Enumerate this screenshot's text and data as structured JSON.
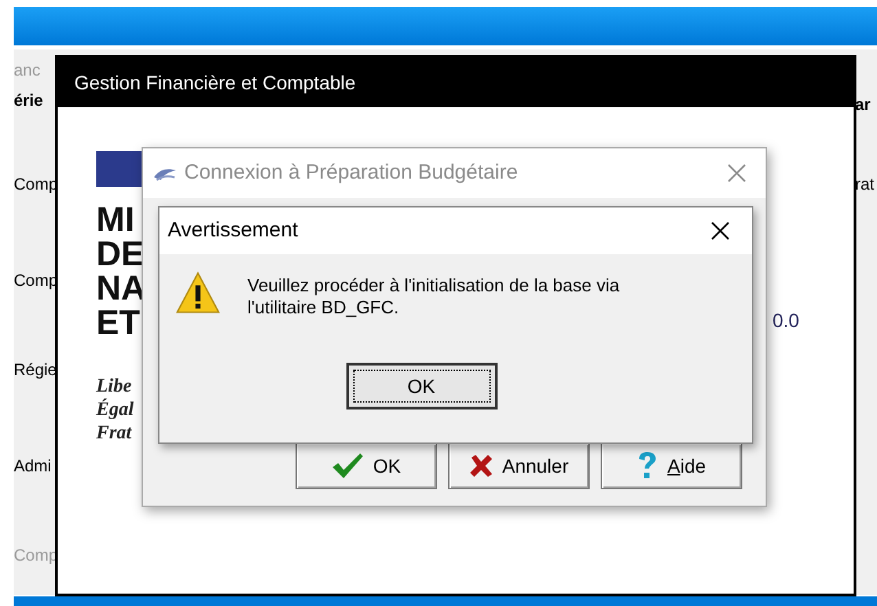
{
  "background_window": {
    "title_fragment": "anc",
    "left_labels": [
      {
        "text": "érie",
        "kind": "header",
        "disabled": false
      },
      {
        "text": "Comp",
        "kind": "entry",
        "disabled": false
      },
      {
        "text": "Comp",
        "kind": "entry",
        "disabled": false
      },
      {
        "text": "Régie",
        "kind": "entry",
        "disabled": false
      },
      {
        "text": "Admi",
        "kind": "entry",
        "disabled": false
      },
      {
        "text": "Comp",
        "kind": "entry",
        "disabled": true
      }
    ],
    "right_labels": [
      {
        "text": "ar",
        "kind": "header"
      },
      {
        "text": "rat",
        "kind": "entry"
      }
    ]
  },
  "main_window": {
    "title": "Gestion Financière et Comptable",
    "logo": {
      "lines": [
        "MI",
        "DE",
        "NA",
        "ET"
      ],
      "motto": [
        "Libe",
        "Égal",
        "Frat"
      ]
    },
    "value_fragment": "0.0"
  },
  "login_dialog": {
    "title": "Connexion à Préparation Budgétaire",
    "active": false,
    "buttons": [
      {
        "label": "OK",
        "kind": "ok"
      },
      {
        "label": "Annuler",
        "kind": "cancel"
      },
      {
        "label": "Aide",
        "kind": "help"
      }
    ]
  },
  "alert_dialog": {
    "title": "Avertissement",
    "active": true,
    "message": "Veuillez procéder à l'initialisation de la base via l'utilitaire BD_GFC.",
    "buttons": [
      {
        "label": "OK",
        "focused": true
      }
    ]
  }
}
